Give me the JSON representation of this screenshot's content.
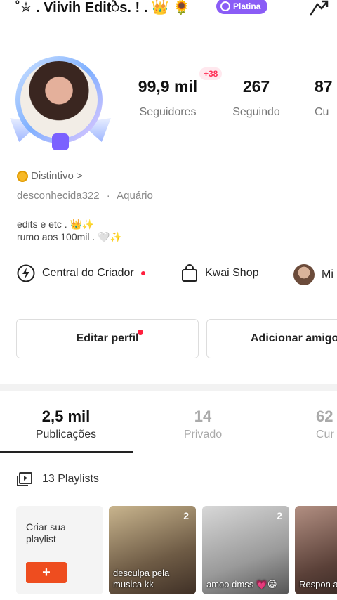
{
  "header": {
    "username": "˚✮ . Viivih Editेs. ! . 👑 🌻",
    "badge": "Platina"
  },
  "stats": [
    {
      "value": "99,9 mil",
      "label": "Seguidores"
    },
    {
      "value": "267",
      "label": "Seguindo"
    },
    {
      "value": "87",
      "label": "Cu"
    }
  ],
  "new_followers_badge": "+38",
  "profile": {
    "distintivo": "Distintivo >",
    "handle": "desconhecida322",
    "separator": "·",
    "sign": "Aquário",
    "bio_line1": "edits e etc . 👑✨",
    "bio_line2": "rumo aos 100mil . 🤍✨"
  },
  "quick_actions": [
    {
      "label": "Central do Criador",
      "icon": "lightning-icon"
    },
    {
      "label": "Kwai Shop",
      "icon": "shopping-bag-icon"
    },
    {
      "label": "Mi",
      "icon": "avatar-icon"
    }
  ],
  "buttons": {
    "edit_profile": "Editar perfil",
    "add_friends": "Adicionar amigos"
  },
  "tabs": [
    {
      "value": "2,5 mil",
      "label": "Publicações",
      "active": true
    },
    {
      "value": "14",
      "label": "Privado",
      "active": false
    },
    {
      "value": "62",
      "label": "Cur",
      "active": false
    }
  ],
  "playlists": {
    "title": "13 Playlists",
    "create_label": "Criar sua playlist",
    "create_button": "+",
    "cards": [
      {
        "count": "2",
        "caption": "desculpa pela musica kk"
      },
      {
        "count": "2",
        "caption": "amoo dmss 💗😁"
      },
      {
        "count": "",
        "caption": "Respon a @Ana"
      }
    ]
  },
  "colors": {
    "accent_red": "#ff1f3d",
    "platina_purple": "#8a5cf6",
    "create_orange": "#ee4d1f"
  }
}
